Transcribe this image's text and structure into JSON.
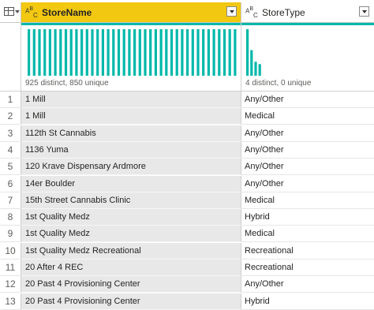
{
  "header": {
    "columns": [
      {
        "name": "StoreName",
        "type_icon": "ABC"
      },
      {
        "name": "StoreType",
        "type_icon": "ABC"
      }
    ]
  },
  "profile": {
    "store_name": {
      "caption": "925 distinct, 850 unique",
      "bar_count": 40,
      "bar_heights_fraction": [
        1,
        1,
        1,
        1,
        1,
        1,
        1,
        1,
        1,
        1,
        1,
        1,
        1,
        1,
        1,
        1,
        1,
        1,
        1,
        1,
        1,
        1,
        1,
        1,
        1,
        1,
        1,
        1,
        1,
        1,
        1,
        1,
        1,
        1,
        1,
        1,
        1,
        1,
        1,
        1
      ]
    },
    "store_type": {
      "caption": "4 distinct, 0 unique",
      "bar_heights_fraction": [
        1.0,
        0.55,
        0.3,
        0.25
      ]
    }
  },
  "rows": [
    {
      "num": "1",
      "store": "1 Mill",
      "type": "Any/Other"
    },
    {
      "num": "2",
      "store": "1 Mill",
      "type": "Medical"
    },
    {
      "num": "3",
      "store": "112th St Cannabis",
      "type": "Any/Other"
    },
    {
      "num": "4",
      "store": "1136 Yuma",
      "type": "Any/Other"
    },
    {
      "num": "5",
      "store": "120 Krave Dispensary Ardmore",
      "type": "Any/Other"
    },
    {
      "num": "6",
      "store": "14er Boulder",
      "type": "Any/Other"
    },
    {
      "num": "7",
      "store": "15th Street Cannabis Clinic",
      "type": "Medical"
    },
    {
      "num": "8",
      "store": "1st Quality Medz",
      "type": "Hybrid"
    },
    {
      "num": "9",
      "store": "1st Quality Medz",
      "type": "Medical"
    },
    {
      "num": "10",
      "store": "1st Quality Medz Recreational",
      "type": "Recreational"
    },
    {
      "num": "11",
      "store": "20 After 4 REC",
      "type": "Recreational"
    },
    {
      "num": "12",
      "store": "20 Past 4 Provisioning Center",
      "type": "Any/Other"
    },
    {
      "num": "13",
      "store": "20 Past 4 Provisioning Center",
      "type": "Hybrid"
    }
  ],
  "colors": {
    "accent": "#f2c811",
    "bars": "#01b8aa"
  }
}
